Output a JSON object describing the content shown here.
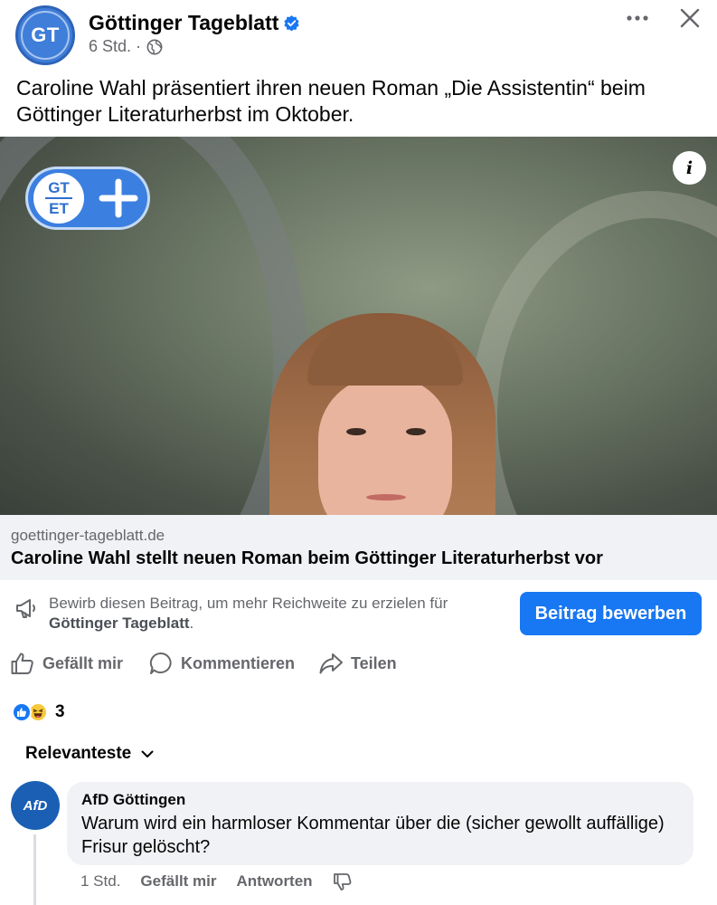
{
  "header": {
    "page_name": "Göttinger Tageblatt",
    "avatar_initials": "GT",
    "time": "6 Std.",
    "separator": "·"
  },
  "post": {
    "text": "Caroline Wahl präsentiert ihren neuen Roman „Die Assistentin“ beim Göttinger Literaturherbst im Oktober."
  },
  "photo": {
    "badge_top": "GT",
    "badge_bottom": "ET",
    "info_label": "i"
  },
  "link": {
    "domain": "goettinger-tageblatt.de",
    "title": "Caroline Wahl stellt neuen Roman beim Göttinger Literaturherbst vor"
  },
  "promote": {
    "text": "Bewirb diesen Beitrag, um mehr Reichweite zu erzielen für",
    "page": "Göttinger Tageblatt",
    "period": ".",
    "button": "Beitrag bewerben"
  },
  "actions": {
    "like": "Gefällt mir",
    "comment": "Kommentieren",
    "share": "Teilen"
  },
  "reactions": {
    "count": "3"
  },
  "comments_sort": {
    "label": "Relevanteste"
  },
  "comment": {
    "avatar_text": "AfD",
    "author": "AfD Göttingen",
    "text": "Warum wird ein harmloser Kommentar über die (sicher gewollt auffällige) Frisur gelöscht?",
    "time": "1 Std.",
    "like": "Gefällt mir",
    "reply": "Antworten"
  },
  "colors": {
    "accent": "#1877f2",
    "secondary_text": "#65676b",
    "bubble": "#f0f2f5",
    "brand_blue": "#3f7ed9"
  }
}
